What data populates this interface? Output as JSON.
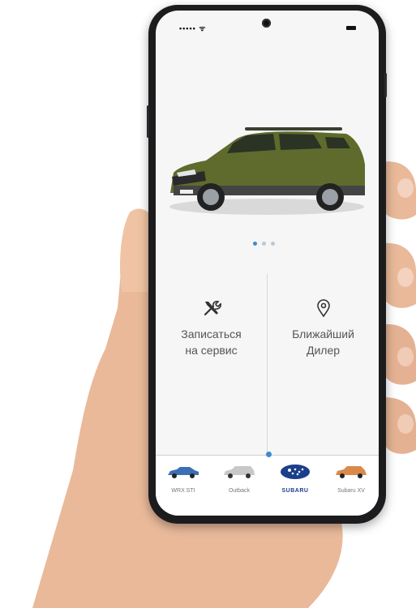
{
  "status_bar": {
    "signal": "••••• ᯤ"
  },
  "carousel": {
    "pages": 3,
    "active_page": 1
  },
  "actions": [
    {
      "label_line1": "Записаться",
      "label_line2": "на сервис",
      "icon": "tools-icon"
    },
    {
      "label_line1": "Ближайший",
      "label_line2": "Дилер",
      "icon": "location-pin-icon"
    }
  ],
  "models": [
    {
      "name": "WRX STI",
      "color": "#3a6fb5"
    },
    {
      "name": "Outback",
      "color": "#c8c8c8"
    },
    {
      "name": "SUBARU",
      "color": "#1b3f8a"
    },
    {
      "name": "Subaru XV",
      "color": "#d98a4a"
    }
  ],
  "colors": {
    "accent": "#3b8bd0",
    "car_body": "#5f6b2c"
  }
}
